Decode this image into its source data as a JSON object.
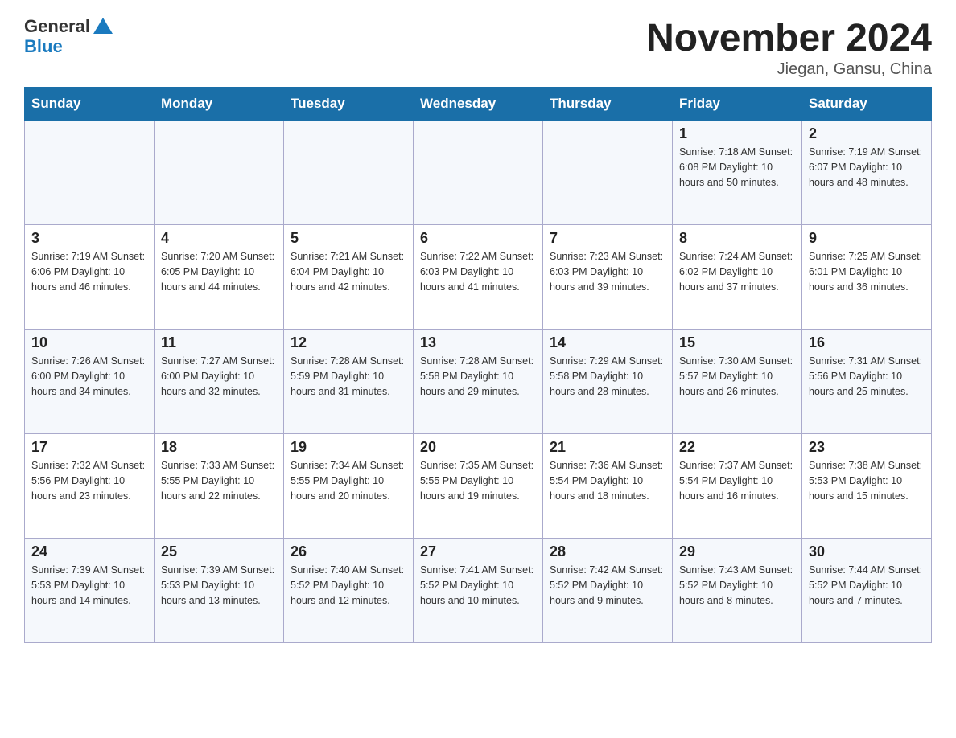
{
  "header": {
    "logo_text_general": "General",
    "logo_text_blue": "Blue",
    "month_title": "November 2024",
    "location": "Jiegan, Gansu, China"
  },
  "days_of_week": [
    "Sunday",
    "Monday",
    "Tuesday",
    "Wednesday",
    "Thursday",
    "Friday",
    "Saturday"
  ],
  "weeks": [
    [
      {
        "day": "",
        "info": ""
      },
      {
        "day": "",
        "info": ""
      },
      {
        "day": "",
        "info": ""
      },
      {
        "day": "",
        "info": ""
      },
      {
        "day": "",
        "info": ""
      },
      {
        "day": "1",
        "info": "Sunrise: 7:18 AM\nSunset: 6:08 PM\nDaylight: 10 hours and 50 minutes."
      },
      {
        "day": "2",
        "info": "Sunrise: 7:19 AM\nSunset: 6:07 PM\nDaylight: 10 hours and 48 minutes."
      }
    ],
    [
      {
        "day": "3",
        "info": "Sunrise: 7:19 AM\nSunset: 6:06 PM\nDaylight: 10 hours and 46 minutes."
      },
      {
        "day": "4",
        "info": "Sunrise: 7:20 AM\nSunset: 6:05 PM\nDaylight: 10 hours and 44 minutes."
      },
      {
        "day": "5",
        "info": "Sunrise: 7:21 AM\nSunset: 6:04 PM\nDaylight: 10 hours and 42 minutes."
      },
      {
        "day": "6",
        "info": "Sunrise: 7:22 AM\nSunset: 6:03 PM\nDaylight: 10 hours and 41 minutes."
      },
      {
        "day": "7",
        "info": "Sunrise: 7:23 AM\nSunset: 6:03 PM\nDaylight: 10 hours and 39 minutes."
      },
      {
        "day": "8",
        "info": "Sunrise: 7:24 AM\nSunset: 6:02 PM\nDaylight: 10 hours and 37 minutes."
      },
      {
        "day": "9",
        "info": "Sunrise: 7:25 AM\nSunset: 6:01 PM\nDaylight: 10 hours and 36 minutes."
      }
    ],
    [
      {
        "day": "10",
        "info": "Sunrise: 7:26 AM\nSunset: 6:00 PM\nDaylight: 10 hours and 34 minutes."
      },
      {
        "day": "11",
        "info": "Sunrise: 7:27 AM\nSunset: 6:00 PM\nDaylight: 10 hours and 32 minutes."
      },
      {
        "day": "12",
        "info": "Sunrise: 7:28 AM\nSunset: 5:59 PM\nDaylight: 10 hours and 31 minutes."
      },
      {
        "day": "13",
        "info": "Sunrise: 7:28 AM\nSunset: 5:58 PM\nDaylight: 10 hours and 29 minutes."
      },
      {
        "day": "14",
        "info": "Sunrise: 7:29 AM\nSunset: 5:58 PM\nDaylight: 10 hours and 28 minutes."
      },
      {
        "day": "15",
        "info": "Sunrise: 7:30 AM\nSunset: 5:57 PM\nDaylight: 10 hours and 26 minutes."
      },
      {
        "day": "16",
        "info": "Sunrise: 7:31 AM\nSunset: 5:56 PM\nDaylight: 10 hours and 25 minutes."
      }
    ],
    [
      {
        "day": "17",
        "info": "Sunrise: 7:32 AM\nSunset: 5:56 PM\nDaylight: 10 hours and 23 minutes."
      },
      {
        "day": "18",
        "info": "Sunrise: 7:33 AM\nSunset: 5:55 PM\nDaylight: 10 hours and 22 minutes."
      },
      {
        "day": "19",
        "info": "Sunrise: 7:34 AM\nSunset: 5:55 PM\nDaylight: 10 hours and 20 minutes."
      },
      {
        "day": "20",
        "info": "Sunrise: 7:35 AM\nSunset: 5:55 PM\nDaylight: 10 hours and 19 minutes."
      },
      {
        "day": "21",
        "info": "Sunrise: 7:36 AM\nSunset: 5:54 PM\nDaylight: 10 hours and 18 minutes."
      },
      {
        "day": "22",
        "info": "Sunrise: 7:37 AM\nSunset: 5:54 PM\nDaylight: 10 hours and 16 minutes."
      },
      {
        "day": "23",
        "info": "Sunrise: 7:38 AM\nSunset: 5:53 PM\nDaylight: 10 hours and 15 minutes."
      }
    ],
    [
      {
        "day": "24",
        "info": "Sunrise: 7:39 AM\nSunset: 5:53 PM\nDaylight: 10 hours and 14 minutes."
      },
      {
        "day": "25",
        "info": "Sunrise: 7:39 AM\nSunset: 5:53 PM\nDaylight: 10 hours and 13 minutes."
      },
      {
        "day": "26",
        "info": "Sunrise: 7:40 AM\nSunset: 5:52 PM\nDaylight: 10 hours and 12 minutes."
      },
      {
        "day": "27",
        "info": "Sunrise: 7:41 AM\nSunset: 5:52 PM\nDaylight: 10 hours and 10 minutes."
      },
      {
        "day": "28",
        "info": "Sunrise: 7:42 AM\nSunset: 5:52 PM\nDaylight: 10 hours and 9 minutes."
      },
      {
        "day": "29",
        "info": "Sunrise: 7:43 AM\nSunset: 5:52 PM\nDaylight: 10 hours and 8 minutes."
      },
      {
        "day": "30",
        "info": "Sunrise: 7:44 AM\nSunset: 5:52 PM\nDaylight: 10 hours and 7 minutes."
      }
    ]
  ]
}
